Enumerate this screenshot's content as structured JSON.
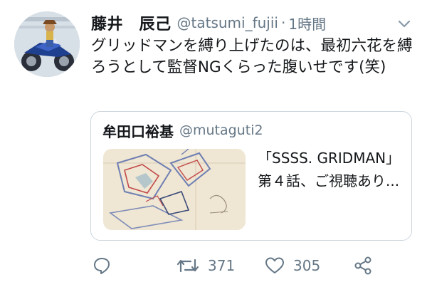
{
  "author": {
    "display_name": "藤井　辰己",
    "handle": "@tatsumi_fujii",
    "separator": "·",
    "timestamp": "1時間"
  },
  "tweet": {
    "text": "グリッドマンを縛り上げたのは、最初六花を縛ろうとして監督NGくらった腹いせです(笑)"
  },
  "quoted": {
    "display_name": "牟田口裕基",
    "handle": "@mutaguti2",
    "text": "「SSSS. GRIDMAN」第４話、ご視聴あり..."
  },
  "actions": {
    "retweet_count": "371",
    "like_count": "305"
  },
  "icons": {
    "reply": "reply-icon",
    "retweet": "retweet-icon",
    "like": "like-icon",
    "share": "share-icon",
    "more": "chevron-down-icon"
  },
  "colors": {
    "text_primary": "#14171a",
    "text_secondary": "#657786",
    "border": "#ccd6dd"
  }
}
